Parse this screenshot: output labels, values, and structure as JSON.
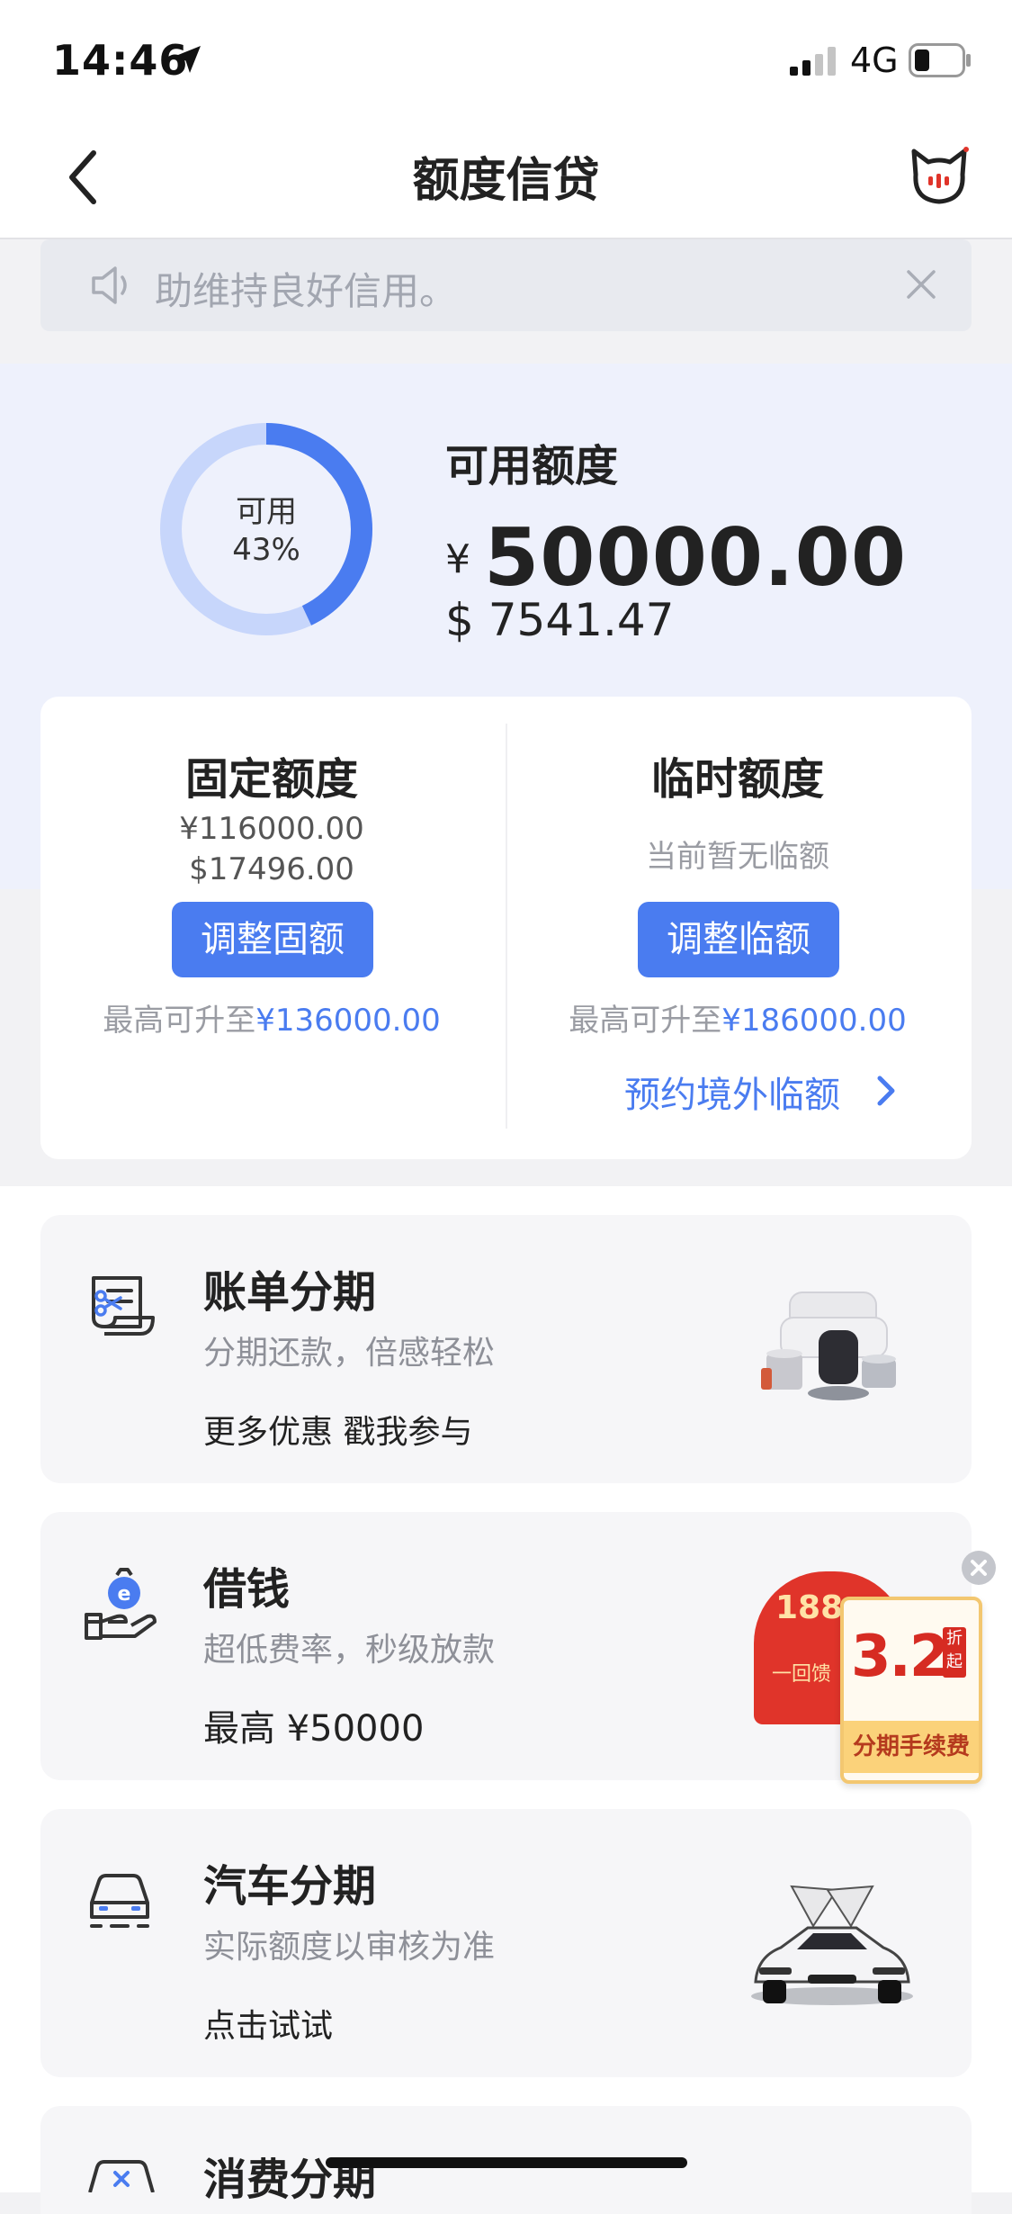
{
  "status_bar": {
    "time": "14:46",
    "network": "4G"
  },
  "nav": {
    "title": "额度信贷"
  },
  "notice": {
    "text": "助维持良好信用。"
  },
  "credit": {
    "ring_label": "可用",
    "ring_percent": "43%",
    "ring_fraction": 0.43,
    "available_title": "可用额度",
    "cny_symbol": "¥",
    "cny_amount": "50000.00",
    "usd_amount": "$ 7541.47"
  },
  "fixed_quota": {
    "title": "固定额度",
    "cny": "¥116000.00",
    "usd": "$17496.00",
    "button": "调整固额",
    "max_prefix": "最高可升至",
    "max_value": "¥136000.00"
  },
  "temp_quota": {
    "title": "临时额度",
    "status": "当前暂无临额",
    "button": "调整临额",
    "max_prefix": "最高可升至",
    "max_value": "¥186000.00",
    "overseas_link": "预约境外临额"
  },
  "services": [
    {
      "title": "账单分期",
      "subtitle": "分期还款，倍感轻松",
      "extra": "更多优惠 戳我参与"
    },
    {
      "title": "借钱",
      "subtitle": "超低费率，秒级放款",
      "extra": "最高 ¥50000"
    },
    {
      "title": "汽车分期",
      "subtitle": "实际额度以审核为准",
      "extra": "点击试试"
    },
    {
      "title": "消费分期"
    }
  ],
  "promo": {
    "envelope_value": "188",
    "envelope_caption": "一回馈",
    "discount": "3.2",
    "discount_unit_1": "折",
    "discount_unit_2": "起",
    "banner": "分期手续费"
  },
  "colors": {
    "accent": "#4a7cf0",
    "ring_track": "#c7d6fb",
    "promo_red": "#e0342a"
  }
}
